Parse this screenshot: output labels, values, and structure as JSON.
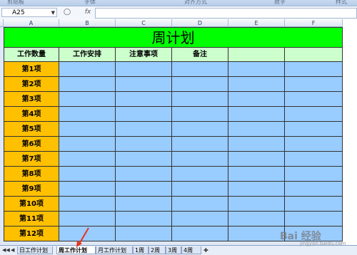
{
  "ribbon": {
    "groups": [
      "剪贴板",
      "字体",
      "对齐方式",
      "数字",
      "样式"
    ]
  },
  "formula": {
    "namebox": "A25",
    "fx": "fx",
    "content": ""
  },
  "columns": [
    "A",
    "B",
    "C",
    "D",
    "E",
    "F"
  ],
  "sheet": {
    "title": "周计划",
    "headers": [
      "工作数量",
      "工作安排",
      "注意事项",
      "备注",
      "",
      ""
    ],
    "rows": [
      "第1项",
      "第2项",
      "第3项",
      "第4项",
      "第5项",
      "第6项",
      "第7项",
      "第8项",
      "第9项",
      "第10项",
      "第11项",
      "第12项"
    ]
  },
  "tabs": [
    "日工作计划",
    "周工作计划",
    "月工作计划",
    "1周",
    "2周",
    "3周",
    "4周"
  ],
  "active_tab": "周工作计划",
  "watermark": {
    "text": "Bai 经验",
    "sub": "jingyan.baidu.com"
  },
  "colors": {
    "title_fill": "#00ff00",
    "header_fill": "#ccffcc",
    "label_fill": "#ffc000",
    "data_fill": "#99ccff",
    "arrow": "#e8321e"
  }
}
